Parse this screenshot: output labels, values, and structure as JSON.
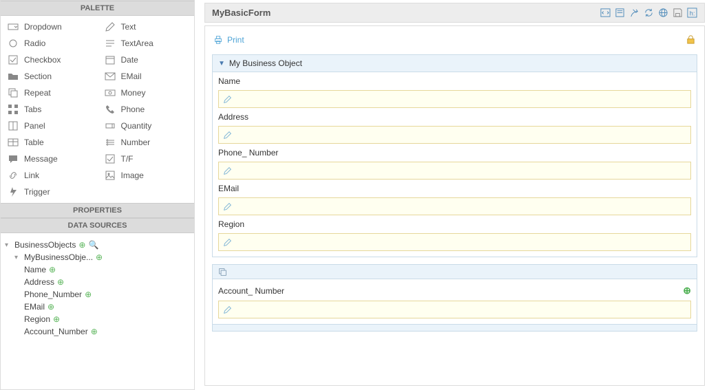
{
  "palette": {
    "header": "PALETTE",
    "col1": [
      {
        "label": "Dropdown",
        "icon": "dropdown"
      },
      {
        "label": "Radio",
        "icon": "radio"
      },
      {
        "label": "Checkbox",
        "icon": "checkbox"
      },
      {
        "label": "Section",
        "icon": "section"
      },
      {
        "label": "Repeat",
        "icon": "repeat"
      },
      {
        "label": "Tabs",
        "icon": "tabs"
      },
      {
        "label": "Panel",
        "icon": "panel"
      },
      {
        "label": "Table",
        "icon": "table"
      },
      {
        "label": "Message",
        "icon": "message"
      },
      {
        "label": "Link",
        "icon": "link"
      },
      {
        "label": "Trigger",
        "icon": "trigger"
      }
    ],
    "col2": [
      {
        "label": "Text",
        "icon": "text"
      },
      {
        "label": "TextArea",
        "icon": "textarea"
      },
      {
        "label": "Date",
        "icon": "date"
      },
      {
        "label": "EMail",
        "icon": "email"
      },
      {
        "label": "Money",
        "icon": "money"
      },
      {
        "label": "Phone",
        "icon": "phone"
      },
      {
        "label": "Quantity",
        "icon": "quantity"
      },
      {
        "label": "Number",
        "icon": "number"
      },
      {
        "label": "T/F",
        "icon": "tf"
      },
      {
        "label": "Image",
        "icon": "image"
      }
    ]
  },
  "properties": {
    "header": "PROPERTIES"
  },
  "datasources": {
    "header": "DATA SOURCES",
    "root": "BusinessObjects",
    "obj": "MyBusinessObje...",
    "fields": [
      "Name",
      "Address",
      "Phone_Number",
      "EMail",
      "Region",
      "Account_Number"
    ]
  },
  "form": {
    "title": "MyBasicForm",
    "print": "Print",
    "section_title": "My Business Object",
    "fields": [
      {
        "label": "Name"
      },
      {
        "label": "Address"
      },
      {
        "label": "Phone_ Number"
      },
      {
        "label": "EMail"
      },
      {
        "label": "Region"
      }
    ],
    "repeat_field": {
      "label": "Account_ Number"
    }
  }
}
